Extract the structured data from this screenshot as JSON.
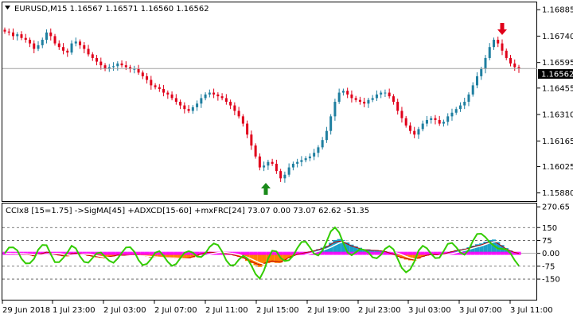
{
  "header": {
    "main_title": "EURUSD,M15  1.16567 1.16571 1.16560 1.16562",
    "indicator_title": "CCIx8 [15=1.75] ->SigMA[45] +ADXCD[15-60] +mxFRC[24] 73.07 0.00 73.07 62.62 -51.35"
  },
  "colors": {
    "bull": "#1f7fa0",
    "bear": "#e0001a",
    "price_line": "#000000",
    "current_price_line": "#a0a0a0",
    "up_arrow": "#1a8a1a",
    "down_arrow": "#e0001a",
    "cci_line": "#33cc00",
    "signal_line": "#ffffff",
    "hist_pos": "#1aa0c8",
    "hist_neg": "#ff8000",
    "hist_zero": "#ff00ff",
    "adx_line": "#c00000"
  },
  "price_axis": {
    "ticks": [
      "1.16885",
      "1.16740",
      "1.16595",
      "1.16455",
      "1.16310",
      "1.16165",
      "1.16025",
      "1.15880"
    ],
    "current_price": "1.16562"
  },
  "indicator_axis": {
    "ticks": [
      "270.65",
      "150",
      "75",
      "0.00",
      "-75",
      "-150"
    ]
  },
  "time_axis": {
    "ticks": [
      "29 Jun 2018",
      "1 Jul 23:00",
      "2 Jul 03:00",
      "2 Jul 07:00",
      "2 Jul 11:00",
      "2 Jul 15:00",
      "2 Jul 19:00",
      "2 Jul 23:00",
      "3 Jul 03:00",
      "3 Jul 07:00",
      "3 Jul 11:00"
    ]
  },
  "chart_data": {
    "type": "candlestick",
    "symbol": "EURUSD",
    "timeframe": "M15",
    "ylim": [
      1.15835,
      1.16925
    ],
    "closes": [
      1.16765,
      1.1676,
      1.1674,
      1.1675,
      1.1673,
      1.1672,
      1.167,
      1.1667,
      1.1669,
      1.1672,
      1.1676,
      1.1674,
      1.167,
      1.1668,
      1.1666,
      1.1665,
      1.167,
      1.1671,
      1.1669,
      1.1667,
      1.1664,
      1.1662,
      1.166,
      1.1658,
      1.1656,
      1.1657,
      1.16575,
      1.1659,
      1.1658,
      1.1657,
      1.1656,
      1.1656,
      1.1654,
      1.1652,
      1.165,
      1.1647,
      1.1646,
      1.1645,
      1.1643,
      1.1642,
      1.164,
      1.1638,
      1.1636,
      1.1634,
      1.1633,
      1.1635,
      1.1637,
      1.164,
      1.1642,
      1.1643,
      1.1642,
      1.1641,
      1.164,
      1.1638,
      1.1636,
      1.1633,
      1.163,
      1.1626,
      1.162,
      1.1614,
      1.1608,
      1.1602,
      1.1603,
      1.1605,
      1.1604,
      1.16,
      1.1596,
      1.1598,
      1.1602,
      1.1604,
      1.1605,
      1.1606,
      1.1607,
      1.1608,
      1.161,
      1.1613,
      1.1617,
      1.1622,
      1.163,
      1.1638,
      1.1643,
      1.1644,
      1.1642,
      1.164,
      1.1639,
      1.1638,
      1.1637,
      1.1639,
      1.164,
      1.1642,
      1.1643,
      1.1643,
      1.1641,
      1.1638,
      1.1633,
      1.1629,
      1.1625,
      1.1622,
      1.162,
      1.1623,
      1.1626,
      1.1628,
      1.1629,
      1.1628,
      1.1626,
      1.1627,
      1.163,
      1.1632,
      1.1634,
      1.1636,
      1.1638,
      1.1642,
      1.1647,
      1.1652,
      1.1656,
      1.1662,
      1.1668,
      1.1672,
      1.167,
      1.1666,
      1.1662,
      1.1659,
      1.1657,
      1.16562
    ]
  }
}
